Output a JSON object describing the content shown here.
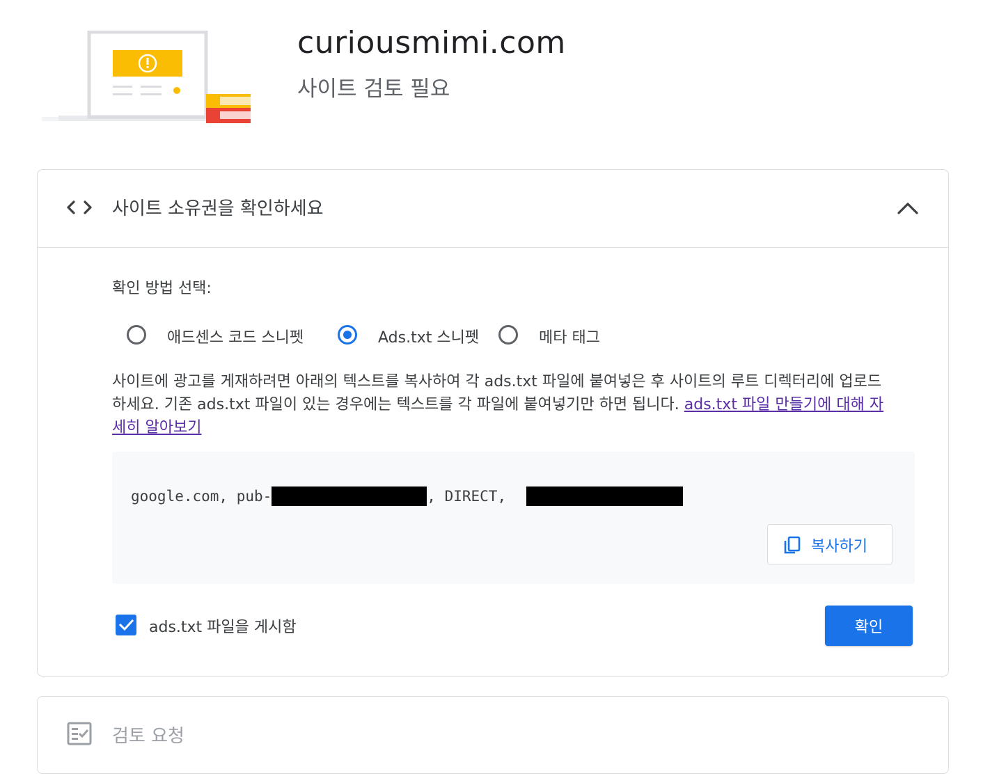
{
  "header": {
    "site_name": "curiousmimi.com",
    "status": "사이트 검토 필요",
    "illustration_icon": "warning-laptop-illustration"
  },
  "ownership_card": {
    "title": "사이트 소유권을 확인하세요",
    "icon": "code-icon",
    "expanded": true,
    "method_label": "확인 방법 선택:",
    "methods": [
      {
        "label": "애드센스 코드 스니펫",
        "selected": false
      },
      {
        "label": "Ads.txt 스니펫",
        "selected": true
      },
      {
        "label": "메타 태그",
        "selected": false
      }
    ],
    "description": "사이트에 광고를 게재하려면 아래의 텍스트를 복사하여 각 ads.txt 파일에 붙여넣은 후 사이트의 루트 디렉터리에 업로드하세요. 기존 ads.txt 파일이 있는 경우에는 텍스트를 각 파일에 붙여넣기만 하면 됩니다. ",
    "learn_more_link": "ads.txt 파일 만들기에 대해 자세히 알아보기",
    "snippet": {
      "prefix": "google.com, pub-",
      "middle": ", DIRECT, "
    },
    "copy_button": "복사하기",
    "checkbox_label": "ads.txt 파일을 게시함",
    "checkbox_checked": true,
    "confirm_button": "확인"
  },
  "review_card": {
    "title": "검토 요청",
    "icon": "checklist-icon"
  },
  "colors": {
    "accent": "#1a73e8",
    "link": "#5a2ea6",
    "text": "#3c4043",
    "muted": "#9aa0a6",
    "border": "#dadce0",
    "code_bg": "#f8f9fa",
    "warning_yellow": "#fbbc04"
  }
}
